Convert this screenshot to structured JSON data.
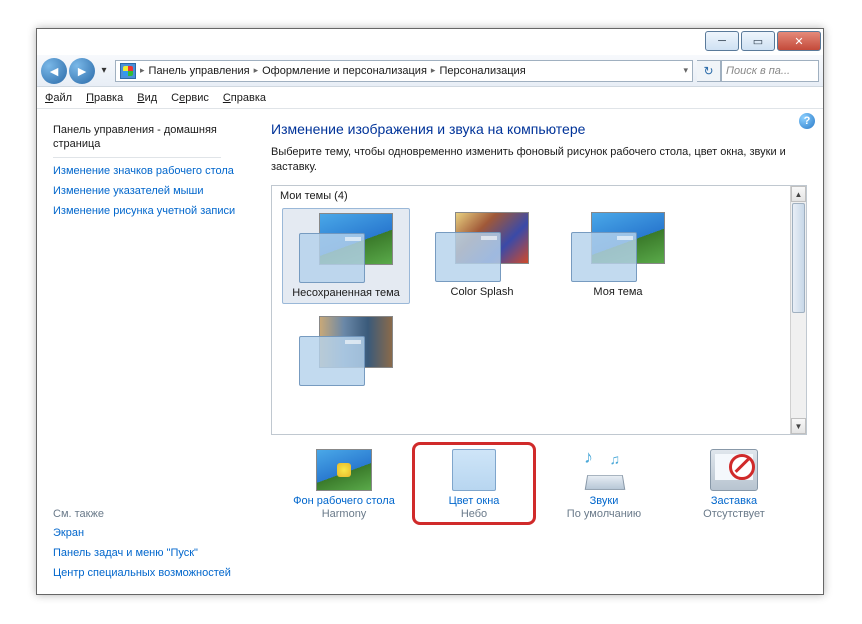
{
  "titlebar": {
    "min": "─",
    "max": "▭",
    "close": "✕"
  },
  "nav": {
    "back_glyph": "◄",
    "fwd_glyph": "►",
    "chev": "▾",
    "addr_chev": "▾",
    "refresh": "↻"
  },
  "breadcrumb": {
    "items": [
      "Панель управления",
      "Оформление и персонализация",
      "Персонализация"
    ],
    "sep": "▸"
  },
  "search": {
    "placeholder": "Поиск в па..."
  },
  "menu": {
    "file": "Файл",
    "edit": "Правка",
    "view": "Вид",
    "tools": "Сервис",
    "help": "Справка"
  },
  "sidebar": {
    "home": "Панель управления - домашняя страница",
    "links": [
      "Изменение значков рабочего стола",
      "Изменение указателей мыши",
      "Изменение рисунка учетной записи"
    ],
    "seealso_label": "См. также",
    "seealso": [
      "Экран",
      "Панель задач и меню \"Пуск\"",
      "Центр специальных возможностей"
    ]
  },
  "content": {
    "heading": "Изменение изображения и звука на компьютере",
    "sub": "Выберите тему, чтобы одновременно изменить фоновый рисунок рабочего стола, цвет окна, звуки и заставку.",
    "mythemes_label": "Мои темы (4)",
    "themes": [
      {
        "name": "Несохраненная тема",
        "variant": "default",
        "selected": true
      },
      {
        "name": "Color Splash",
        "variant": "splash",
        "selected": false
      },
      {
        "name": "Моя тема",
        "variant": "default",
        "selected": false
      },
      {
        "name": "",
        "variant": "harmony",
        "selected": false
      }
    ],
    "help_glyph": "?"
  },
  "bottom": {
    "wallpaper": {
      "label": "Фон рабочего стола",
      "value": "Harmony"
    },
    "color": {
      "label": "Цвет окна",
      "value": "Небо"
    },
    "sounds": {
      "label": "Звуки",
      "value": "По умолчанию"
    },
    "saver": {
      "label": "Заставка",
      "value": "Отсутствует"
    }
  },
  "scroll": {
    "up": "▲",
    "down": "▼"
  }
}
